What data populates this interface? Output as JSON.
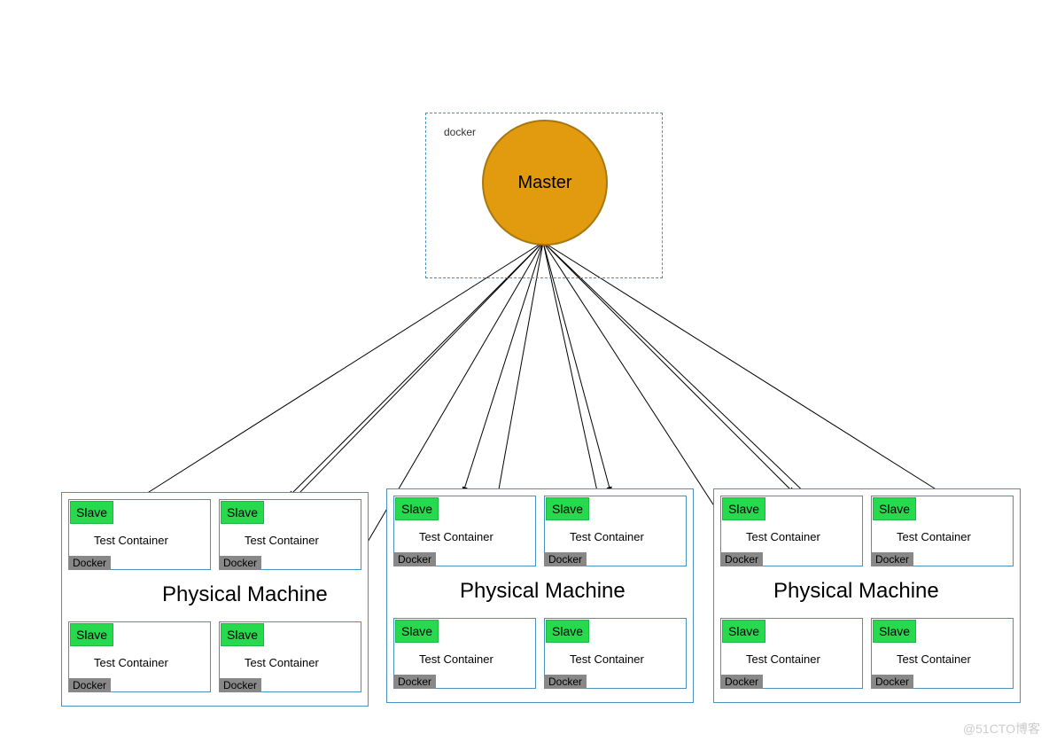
{
  "master": {
    "boxLabel": "docker",
    "circleLabel": "Master"
  },
  "physicalMachines": [
    {
      "label": "Physical Machine",
      "slaves": [
        {
          "slave": "Slave",
          "test": "Test Container",
          "docker": "Docker"
        },
        {
          "slave": "Slave",
          "test": "Test Container",
          "docker": "Docker"
        },
        {
          "slave": "Slave",
          "test": "Test Container",
          "docker": "Docker"
        },
        {
          "slave": "Slave",
          "test": "Test Container",
          "docker": "Docker"
        }
      ]
    },
    {
      "label": "Physical Machine",
      "slaves": [
        {
          "slave": "Slave",
          "test": "Test Container",
          "docker": "Docker"
        },
        {
          "slave": "Slave",
          "test": "Test Container",
          "docker": "Docker"
        },
        {
          "slave": "Slave",
          "test": "Test Container",
          "docker": "Docker"
        },
        {
          "slave": "Slave",
          "test": "Test Container",
          "docker": "Docker"
        }
      ]
    },
    {
      "label": "Physical Machine",
      "slaves": [
        {
          "slave": "Slave",
          "test": "Test Container",
          "docker": "Docker"
        },
        {
          "slave": "Slave",
          "test": "Test Container",
          "docker": "Docker"
        },
        {
          "slave": "Slave",
          "test": "Test Container",
          "docker": "Docker"
        },
        {
          "slave": "Slave",
          "test": "Test Container",
          "docker": "Docker"
        }
      ]
    }
  ],
  "watermark": "@51CTO博客"
}
